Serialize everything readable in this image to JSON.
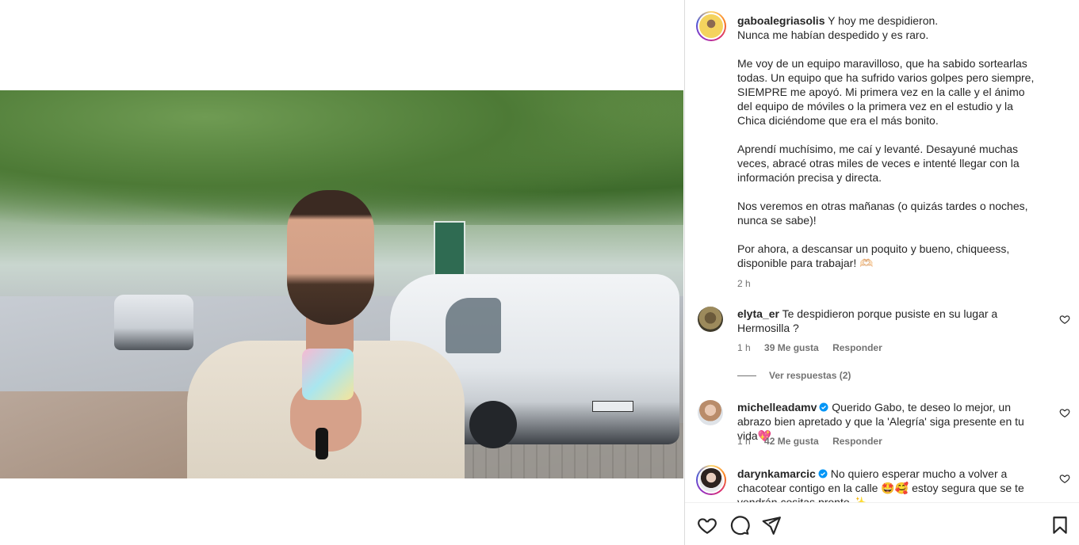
{
  "post": {
    "username": "gaboalegriasolis",
    "caption_paragraphs": [
      "Y hoy me despidieron.\nNunca me habían despedido y es raro.",
      "Me voy de un equipo maravilloso, que ha sabido sortearlas todas. Un equipo que ha sufrido varios golpes pero siempre, SIEMPRE me apoyó. Mi primera vez en la calle y el ánimo del equipo de móviles o la primera vez en el estudio y la Chica diciéndome que era el más bonito.",
      "Aprendí muchísimo, me caí y levanté. Desayuné muchas veces, abracé otras miles de veces e intenté llegar con la información precisa y directa.",
      "Nos veremos en otras mañanas (o quizás tardes o noches, nunca se sabe)!",
      "Por ahora, a descansar un poquito y bueno, chiqueess, disponible para trabajar! 🫶🏻"
    ],
    "time": "2 h"
  },
  "comments": [
    {
      "username": "elyta_er",
      "text": "Te despidieron porque pusiste en su lugar a Hermosilla ?",
      "time": "1 h",
      "likes": "39 Me gusta",
      "reply": "Responder",
      "view_replies": "Ver respuestas (2)"
    },
    {
      "username": "michelleadamv",
      "text": "Querido Gabo, te deseo lo mejor, un abrazo bien apretado y que la 'Alegría' siga presente en tu vida💖",
      "time": "1 h",
      "likes": "42 Me gusta",
      "reply": "Responder"
    },
    {
      "username": "darynkamarcic",
      "text": "No quiero esperar mucho a volver a chacotear contigo en la calle 🤩🥰 estoy segura que se te vendrán cositas pronto ✨"
    }
  ],
  "icons": {
    "like": "heart-icon",
    "comment": "comment-icon",
    "share": "share-icon",
    "save": "bookmark-icon",
    "verified": "verified-badge-icon"
  },
  "colors": {
    "text": "#262626",
    "muted": "#737373",
    "verified": "#0095f6",
    "divider": "#dbdbdb"
  }
}
